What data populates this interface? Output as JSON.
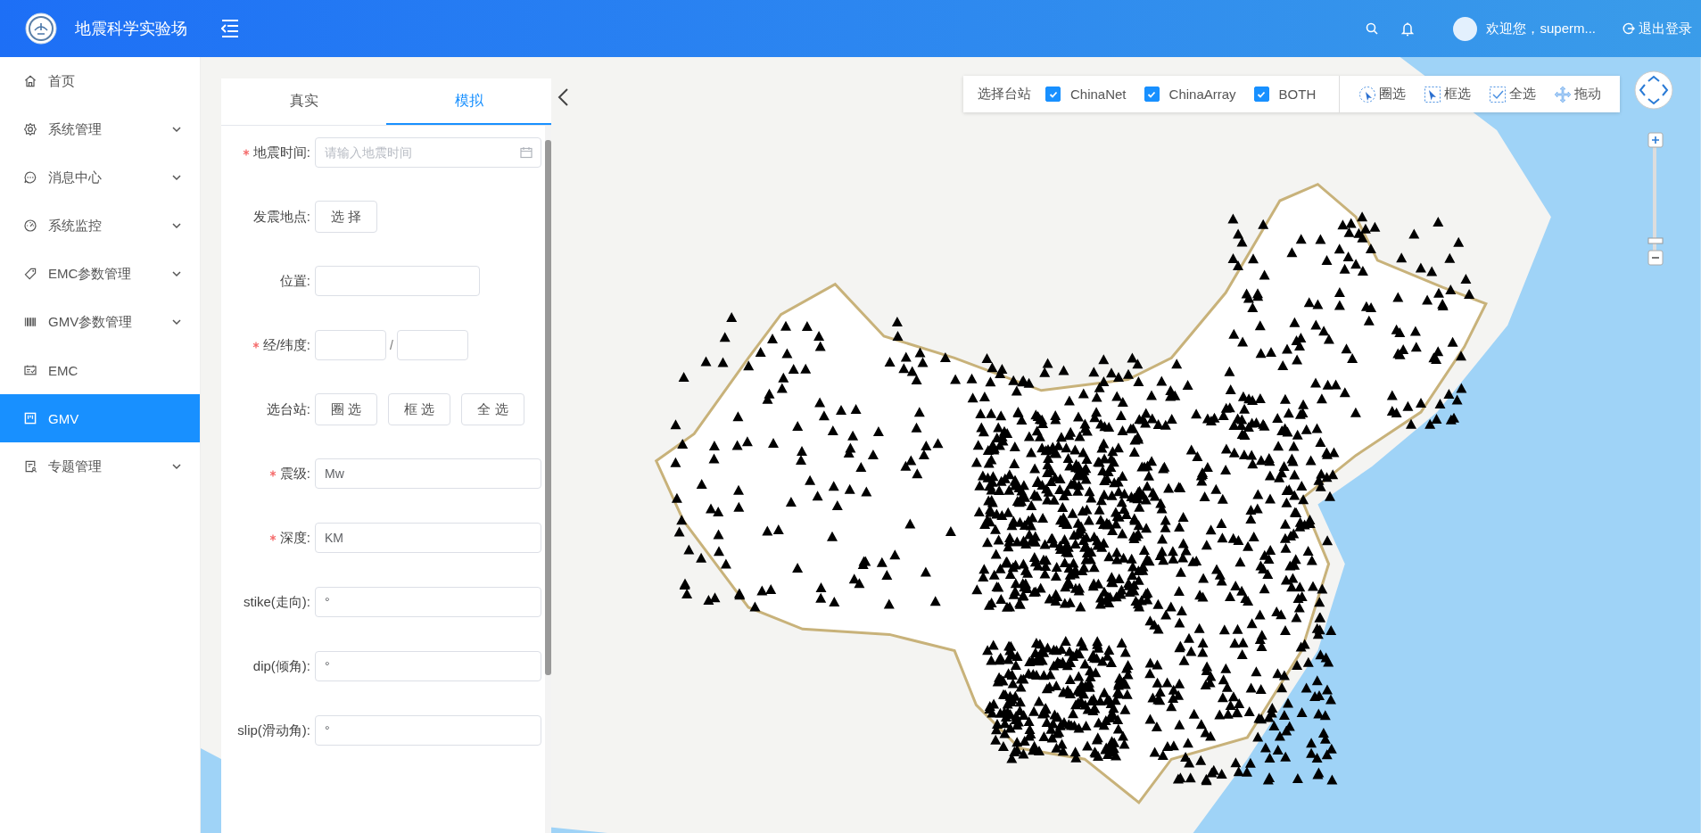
{
  "header": {
    "title": "地震科学实验场",
    "user_greeting": "欢迎您，superm...",
    "logout": "退出登录"
  },
  "sidebar": {
    "items": [
      {
        "label": "首页",
        "expandable": false,
        "selected": false
      },
      {
        "label": "系统管理",
        "expandable": true,
        "selected": false
      },
      {
        "label": "消息中心",
        "expandable": true,
        "selected": false
      },
      {
        "label": "系统监控",
        "expandable": true,
        "selected": false
      },
      {
        "label": "EMC参数管理",
        "expandable": true,
        "selected": false
      },
      {
        "label": "GMV参数管理",
        "expandable": true,
        "selected": false
      },
      {
        "label": "EMC",
        "expandable": false,
        "selected": false
      },
      {
        "label": "GMV",
        "expandable": false,
        "selected": true
      },
      {
        "label": "专题管理",
        "expandable": true,
        "selected": false
      }
    ]
  },
  "panel": {
    "tabs": [
      {
        "label": "真实",
        "selected": false
      },
      {
        "label": "模拟",
        "selected": true
      }
    ],
    "fields": [
      {
        "kind": "date",
        "label": "地震时间:",
        "required": true,
        "placeholder": "请输入地震时间"
      },
      {
        "kind": "buttons",
        "label": "发震地点:",
        "required": false,
        "buttons": [
          "选 择"
        ]
      },
      {
        "kind": "input",
        "label": "位置:",
        "required": false
      },
      {
        "kind": "pair",
        "label": "经/纬度:",
        "required": true,
        "separator": "/"
      },
      {
        "kind": "buttons",
        "label": "选台站:",
        "required": false,
        "buttons": [
          "圈 选",
          "框 选",
          "全 选"
        ]
      },
      {
        "kind": "input",
        "label": "震级:",
        "required": true,
        "value": "Mw"
      },
      {
        "kind": "input",
        "label": "深度:",
        "required": true,
        "value": "KM"
      },
      {
        "kind": "input",
        "label": "stike(走向):",
        "required": false,
        "value": "°"
      },
      {
        "kind": "input",
        "label": "dip(倾角):",
        "required": false,
        "value": "°"
      },
      {
        "kind": "input",
        "label": "slip(滑动角):",
        "required": false,
        "value": "°"
      }
    ]
  },
  "toolbar": {
    "label": "选择台站",
    "networks": [
      {
        "label": "ChinaNet",
        "checked": true
      },
      {
        "label": "ChinaArray",
        "checked": true
      },
      {
        "label": "BOTH",
        "checked": true
      }
    ],
    "tools": [
      {
        "label": "圈选"
      },
      {
        "label": "框选"
      },
      {
        "label": "全选"
      },
      {
        "label": "拖动"
      }
    ]
  }
}
